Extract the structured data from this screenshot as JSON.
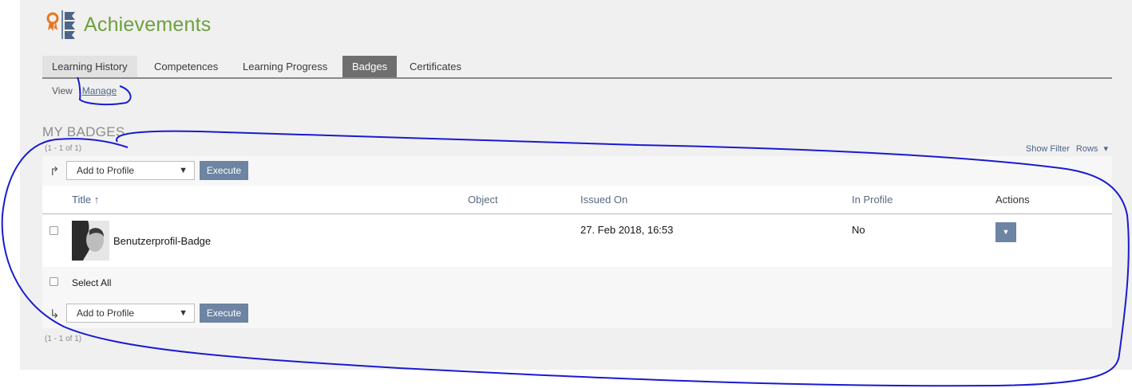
{
  "header": {
    "title": "Achievements",
    "icon": "achievements-icon"
  },
  "tabs": [
    {
      "label": "Learning History"
    },
    {
      "label": "Competences"
    },
    {
      "label": "Learning Progress"
    },
    {
      "label": "Badges"
    },
    {
      "label": "Certificates"
    }
  ],
  "active_tab": "Badges",
  "subtabs": {
    "view": "View",
    "manage": "Manage"
  },
  "section": {
    "title": "MY BADGES",
    "count_top": "(1 - 1 of 1)",
    "count_bottom": "(1 - 1 of 1)"
  },
  "filter": {
    "show_filter": "Show Filter",
    "rows": "Rows"
  },
  "command": {
    "select_value": "Add to Profile",
    "execute_label": "Execute"
  },
  "table": {
    "columns": [
      "Title",
      "Object",
      "Issued On",
      "In Profile",
      "Actions"
    ],
    "sort_indicator": "↑",
    "rows": [
      {
        "title": "Benutzerprofil-Badge",
        "object": "",
        "issued_on": "27. Feb 2018, 16:53",
        "in_profile": "No"
      }
    ],
    "select_all": "Select All"
  },
  "colors": {
    "accent_green": "#6ea03c",
    "button_blue": "#6d84a2",
    "link_blue": "#4c6586",
    "annotation": "#1a1ad0"
  }
}
